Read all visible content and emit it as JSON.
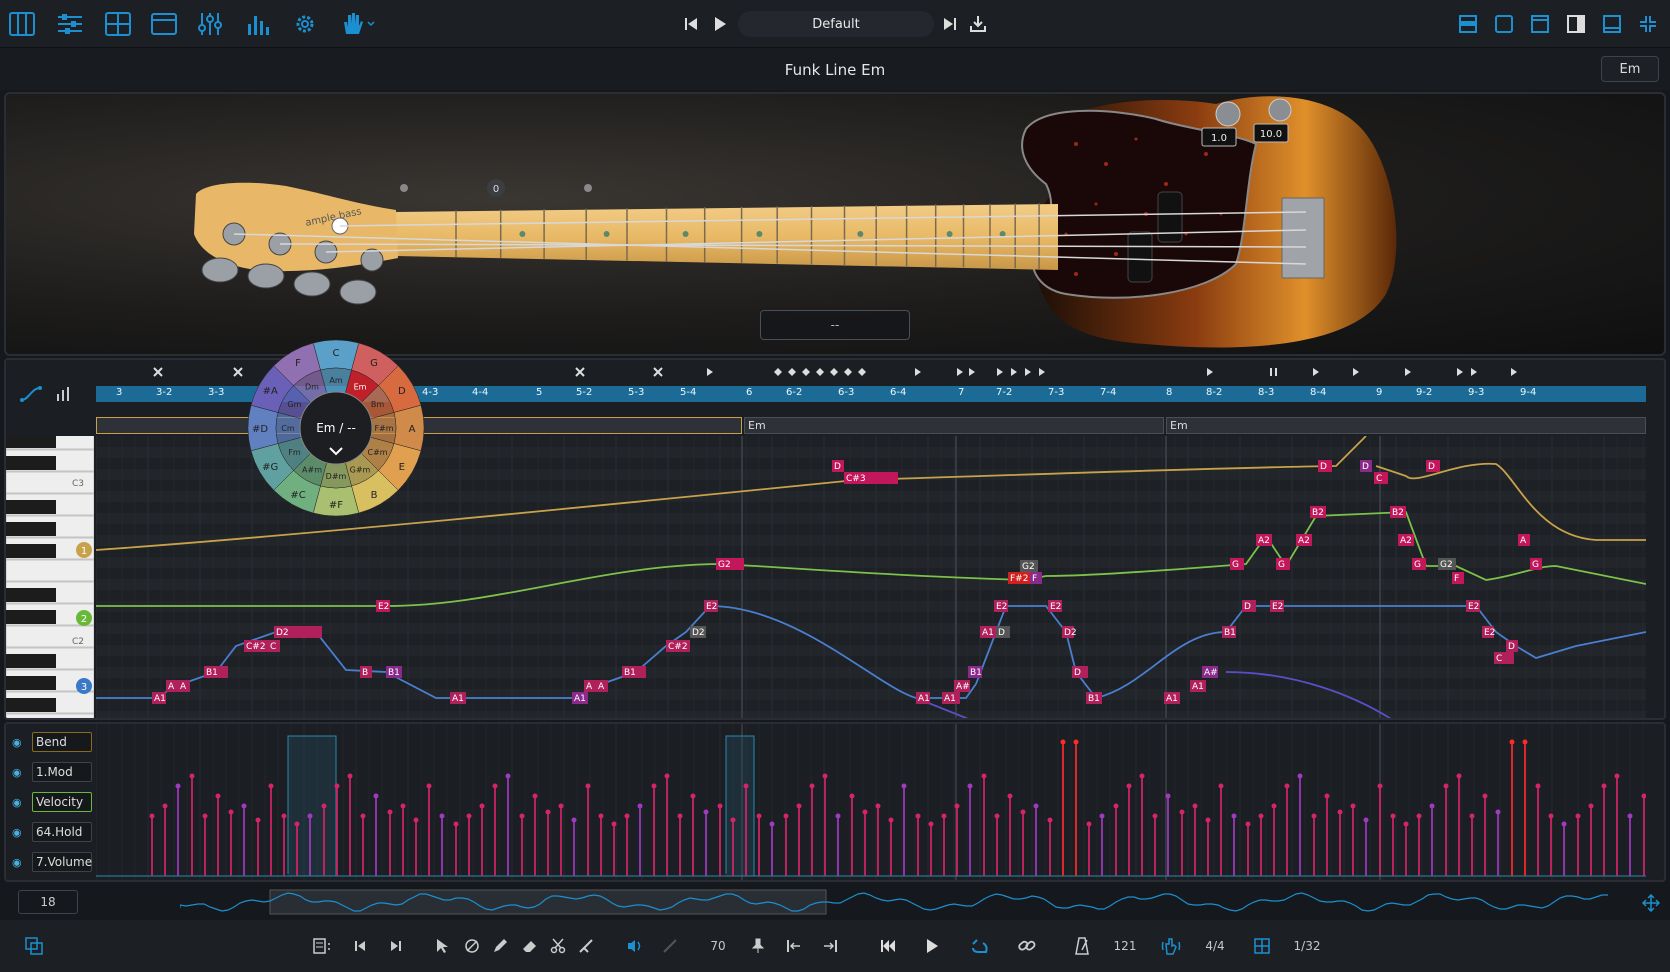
{
  "toolbar": {
    "preset_name": "Default",
    "left_icons": [
      "keyboard-icon",
      "mixer-sliders-icon",
      "sequencer-icon",
      "window-icon",
      "eq-sliders-icon",
      "bars-icon",
      "gear-icon",
      "hand-icon"
    ],
    "right_icons": [
      "layout-1-icon",
      "layout-2-icon",
      "layout-3-icon",
      "layout-4-icon",
      "layout-5-icon",
      "collapse-icon"
    ]
  },
  "instrument": {
    "title": "Funk Line Em",
    "key": "Em",
    "knob_values": [
      "1.0",
      "10.0"
    ],
    "fret_marker": "0",
    "articulation": "--",
    "headstock_brand": "ample bass"
  },
  "chord_wheel": {
    "center": "Em / --",
    "outer": [
      "C",
      "G",
      "D",
      "A",
      "E",
      "B",
      "#F",
      "#C",
      "#G",
      "#D",
      "#A",
      "F"
    ],
    "inner": [
      "Am",
      "Em",
      "Bm",
      "F#m",
      "C#m",
      "G#m",
      "D#m",
      "A#m",
      "Fm",
      "Cm",
      "Gm",
      "Dm"
    ]
  },
  "ruler": {
    "labels": [
      "3",
      "3-2",
      "3-3",
      "4-3",
      "4-4",
      "5",
      "5-2",
      "5-3",
      "5-4",
      "6",
      "6-2",
      "6-3",
      "6-4",
      "7",
      "7-2",
      "7-3",
      "7-4",
      "8",
      "8-2",
      "8-3",
      "8-4",
      "9",
      "9-2",
      "9-3",
      "9-4"
    ]
  },
  "chord_lane": {
    "segments": [
      "",
      "Em",
      "Em"
    ]
  },
  "keyboard": {
    "labels": [
      "C3",
      "C2"
    ],
    "string_badges": [
      "1",
      "2",
      "3"
    ]
  },
  "notes": {
    "s3": [
      "A1",
      "A",
      "A",
      "B1",
      "C#2",
      "C",
      "D2",
      "B",
      "B1",
      "A1",
      "A1",
      "A",
      "A",
      "B1",
      "C#2",
      "D2",
      "E2",
      "A1",
      "A1",
      "A#",
      "B1",
      "A1",
      "D",
      "E2",
      "E2",
      "D2",
      "D",
      "B1",
      "A1",
      "A1",
      "A#",
      "B1",
      "D",
      "E2",
      "E2",
      "E2",
      "D",
      "C",
      "C2"
    ],
    "s2": [
      "E2",
      "G2",
      "F#2",
      "F",
      "G2",
      "G",
      "A2",
      "G",
      "A2",
      "B2",
      "B2",
      "A2",
      "G",
      "G2",
      "F",
      "G"
    ],
    "s1": [
      "C#3",
      "D",
      "D",
      "D",
      "C",
      "D",
      "A"
    ]
  },
  "controllers": {
    "lanes": [
      "Bend",
      "1.Mod",
      "Velocity",
      "64.Hold",
      "7.Volume"
    ],
    "selected": "Velocity"
  },
  "overview": {
    "zoom": "18"
  },
  "bottombar": {
    "velocity": "70",
    "tempo": "121",
    "time_signature": "4/4",
    "quantize": "1/32"
  },
  "colors": {
    "accent": "#1c8fd0",
    "note_s3": "#b0205a",
    "note_s2": "#c2185b",
    "curve_s1": "#c8a24a",
    "curve_s2": "#7cc24a",
    "curve_s3": "#4a7fd0",
    "velocity_bar": "#d4246a"
  }
}
